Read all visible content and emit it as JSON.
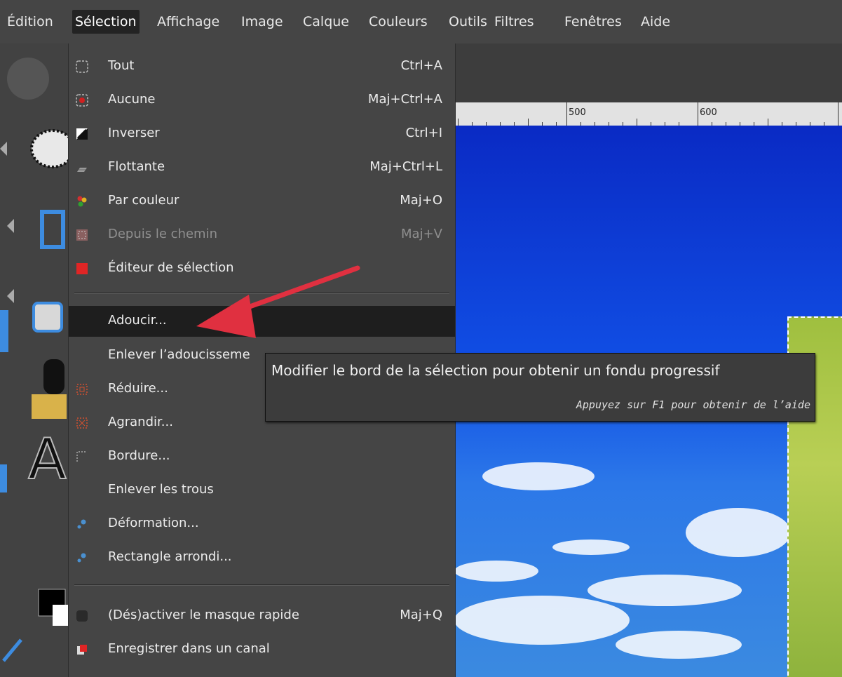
{
  "menubar": {
    "items": [
      "Édition",
      "Sélection",
      "Affichage",
      "Image",
      "Calque",
      "Couleurs",
      "Outils",
      "Filtres",
      "Fenêtres",
      "Aide"
    ],
    "active": "Sélection"
  },
  "ruler": {
    "labels": [
      "500",
      "600"
    ]
  },
  "menu": {
    "items": [
      {
        "label": "Tout",
        "accel": "Ctrl+A",
        "icon": "select-all-icon"
      },
      {
        "label": "Aucune",
        "accel": "Maj+Ctrl+A",
        "icon": "select-none-icon"
      },
      {
        "label": "Inverser",
        "accel": "Ctrl+I",
        "icon": "invert-icon"
      },
      {
        "label": "Flottante",
        "accel": "Maj+Ctrl+L",
        "icon": "float-icon"
      },
      {
        "label": "Par couleur",
        "accel": "Maj+O",
        "icon": "by-color-icon"
      },
      {
        "label": "Depuis le chemin",
        "accel": "Maj+V",
        "icon": "from-path-icon",
        "disabled": true
      },
      {
        "label": "Éditeur de sélection",
        "accel": "",
        "icon": "selection-editor-icon"
      },
      {
        "label": "Adoucir...",
        "accel": "",
        "icon": "",
        "highlighted": true
      },
      {
        "label": "Enlever l’adoucisseme",
        "accel": "",
        "icon": ""
      },
      {
        "label": "Réduire...",
        "accel": "",
        "icon": "shrink-icon"
      },
      {
        "label": "Agrandir...",
        "accel": "",
        "icon": "grow-icon"
      },
      {
        "label": "Bordure...",
        "accel": "",
        "icon": "border-icon"
      },
      {
        "label": "Enlever les trous",
        "accel": "",
        "icon": ""
      },
      {
        "label": "Déformation...",
        "accel": "",
        "icon": "distort-icon"
      },
      {
        "label": "Rectangle arrondi...",
        "accel": "",
        "icon": "rounded-rect-icon"
      },
      {
        "label": "(Dés)activer le masque rapide",
        "accel": "Maj+Q",
        "icon": "quick-mask-icon"
      },
      {
        "label": "Enregistrer dans un canal",
        "accel": "",
        "icon": "save-channel-icon"
      }
    ]
  },
  "tooltip": {
    "text": "Modifier le bord de la sélection pour obtenir un fondu progressif",
    "help": "Appuyez sur F1 pour obtenir de l’aide"
  },
  "colors": {
    "arrow": "#e03040",
    "menu_bg": "#454545",
    "highlight_bg": "#1e1e1e"
  }
}
